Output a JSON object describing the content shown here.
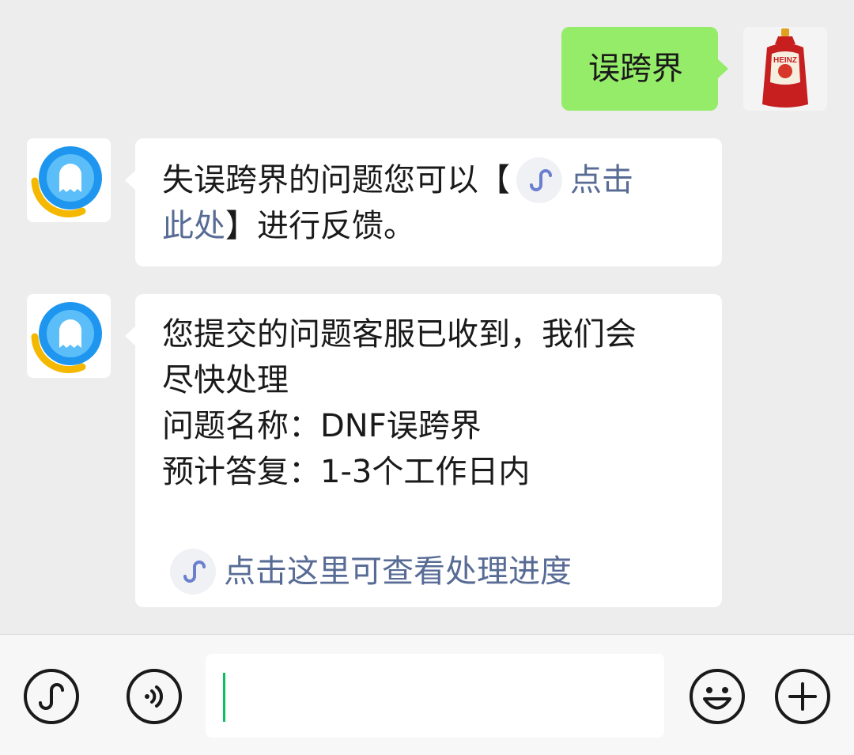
{
  "messages": {
    "sent": {
      "text": "误跨界",
      "avatar_icon": "ketchup-bottle-avatar",
      "brand_text": "HEINZ"
    },
    "reply1": {
      "avatar_icon": "qq-support-avatar",
      "text_before": "失误跨界的问题您可以【",
      "link_part1": "点击",
      "link_part2": "此处",
      "text_after": "】进行反馈。",
      "link_icon": "mini-program-icon"
    },
    "reply2": {
      "avatar_icon": "qq-support-avatar",
      "line1": "您提交的问题客服已收到，我们会",
      "line2": "尽快处理",
      "line3": "问题名称：DNF误跨界",
      "line4": "预计答复：1-3个工作日内",
      "link_text": "点击这里可查看处理进度",
      "link_icon": "mini-program-icon"
    }
  },
  "input_bar": {
    "left_icons": [
      "mini-program-icon",
      "voice-icon"
    ],
    "right_icons": [
      "emoji-icon",
      "plus-icon"
    ],
    "input_value": ""
  },
  "colors": {
    "background": "#ededed",
    "sent_bubble": "#95ec69",
    "link": "#576b95",
    "caret": "#07c160"
  }
}
